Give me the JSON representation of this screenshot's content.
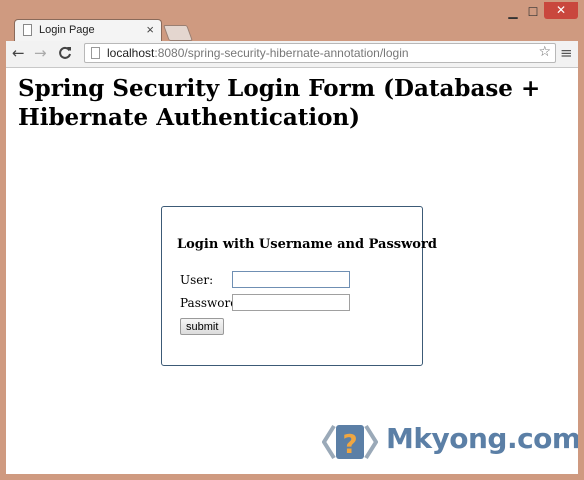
{
  "browser": {
    "tab_title": "Login Page",
    "tab_close": "×",
    "url_host": "localhost",
    "url_rest": ":8080/spring-security-hibernate-annotation/login",
    "window_controls": {
      "minimize": "▁",
      "maximize": "☐",
      "close": "✕"
    },
    "nav": {
      "back": "←",
      "forward": "→",
      "reload": "C"
    },
    "bookmark_star": "☆",
    "menu": "≡"
  },
  "page": {
    "title": "Spring Security Login Form (Database + Hibernate Authentication)",
    "login": {
      "heading": "Login with Username and Password",
      "user_label": "User:",
      "password_label": "Password:",
      "user_value": "",
      "password_value": "",
      "submit_label": "submit"
    }
  },
  "watermark": {
    "text": "Mkyong.com"
  },
  "colors": {
    "frame": "#cf9a80",
    "box_border": "#3c5a76",
    "brand": "#5b7fa6"
  }
}
